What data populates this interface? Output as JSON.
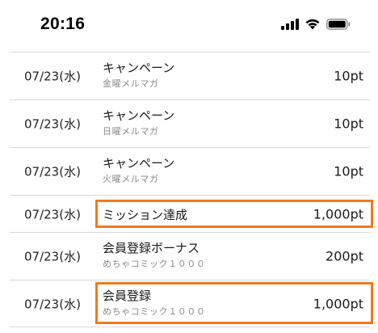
{
  "status_bar": {
    "time": "20:16",
    "icons": [
      "cellular-signal-icon",
      "wifi-icon",
      "battery-icon"
    ]
  },
  "history": {
    "rows": [
      {
        "date": "07/23(水)",
        "title": "キャンペーン",
        "sub": "金曜メルマガ",
        "points": "10pt",
        "highlighted": false
      },
      {
        "date": "07/23(水)",
        "title": "キャンペーン",
        "sub": "日曜メルマガ",
        "points": "10pt",
        "highlighted": false
      },
      {
        "date": "07/23(水)",
        "title": "キャンペーン",
        "sub": "火曜メルマガ",
        "points": "10pt",
        "highlighted": false
      },
      {
        "date": "07/23(水)",
        "title": "ミッション達成",
        "sub": "",
        "points": "1,000pt",
        "highlighted": true
      },
      {
        "date": "07/23(水)",
        "title": "会員登録ボーナス",
        "sub": "めちゃコミック１０００",
        "points": "200pt",
        "highlighted": false
      },
      {
        "date": "07/23(水)",
        "title": "会員登録",
        "sub": "めちゃコミック１０００",
        "points": "1,000pt",
        "highlighted": true
      }
    ]
  },
  "colors": {
    "highlight": "#f07a1c",
    "divider": "#d9d9d9",
    "subtext": "#8a8a8a"
  }
}
